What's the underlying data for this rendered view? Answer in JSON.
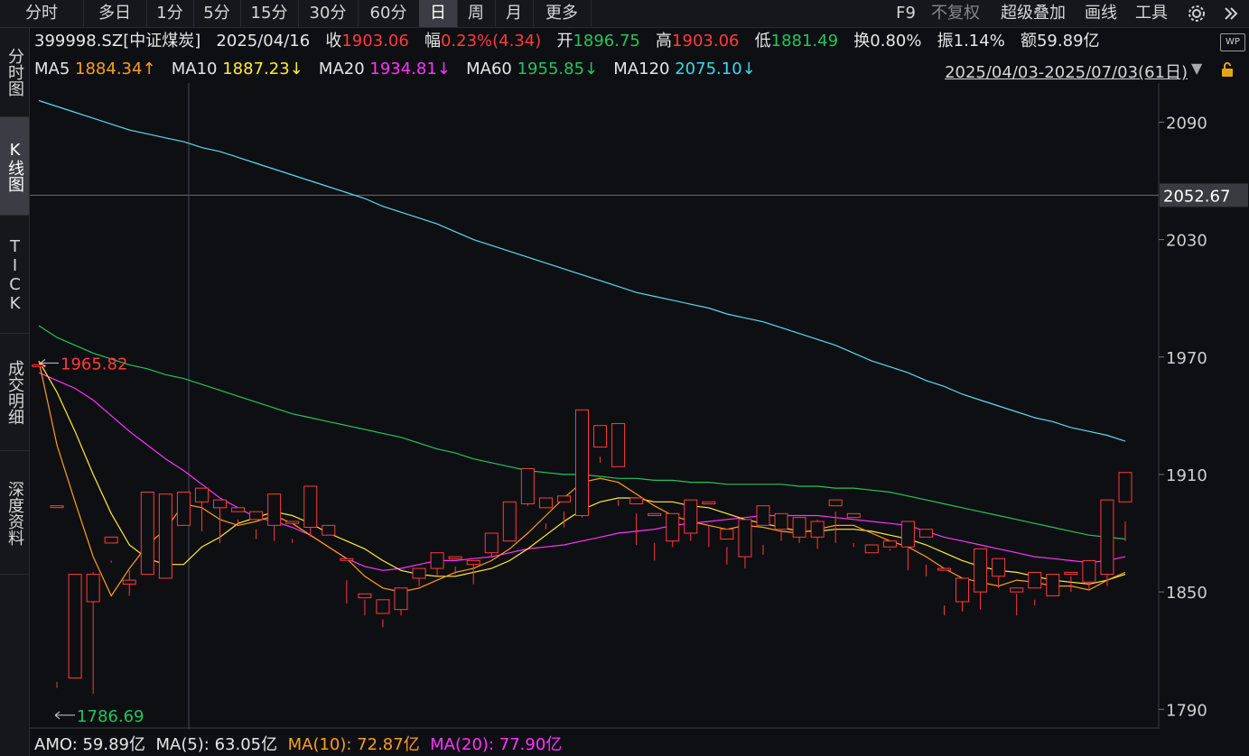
{
  "toolbar": {
    "tabs": [
      "分时",
      "多日",
      "1分",
      "5分",
      "15分",
      "30分",
      "60分",
      "日",
      "周",
      "月",
      "更多"
    ],
    "active_tab": "日",
    "right_tools": [
      "F9",
      "不复权",
      "超级叠加",
      "画线",
      "工具"
    ]
  },
  "sidebar": {
    "tabs": [
      "分时图",
      "K线图",
      "TICK",
      "成交明细",
      "深度资料"
    ],
    "active_tab": "K线图"
  },
  "info": {
    "symbol": "399998.SZ[中证煤炭]",
    "date": "2025/04/16",
    "close_label": "收",
    "close": "1903.06",
    "change_label": "幅",
    "change": "0.23%(4.34)",
    "open_label": "开",
    "open": "1896.75",
    "high_label": "高",
    "high": "1903.06",
    "low_label": "低",
    "low": "1881.49",
    "turnover_label": "换",
    "turnover": "0.80%",
    "amplitude_label": "振",
    "amplitude": "1.14%",
    "amount_label": "额",
    "amount": "59.89亿",
    "wp_badge": "WP"
  },
  "ma_line": {
    "ma5_label": "MA5",
    "ma5": "1884.34↑",
    "ma10_label": "MA10",
    "ma10": "1887.23↓",
    "ma20_label": "MA20",
    "ma20": "1934.81↓",
    "ma60_label": "MA60",
    "ma60": "1955.85↓",
    "ma120_label": "MA120",
    "ma120": "2075.10↓"
  },
  "range": "2025/04/03-2025/07/03(61日)",
  "amo": {
    "amo": "AMO: 59.89亿",
    "ma5": "MA(5): 63.05亿",
    "ma10": "MA(10): 72.87亿",
    "ma20": "MA(20): 77.90亿"
  },
  "colors": {
    "up": "#ff3b3b",
    "down": "#33d6d6",
    "ma5": "#ff9d1a",
    "ma10": "#ffee33",
    "ma20": "#ff33ff",
    "ma60": "#22c55e",
    "ma120": "#55ddee"
  },
  "chart_data": {
    "type": "candlestick",
    "y_ticks": [
      "2090",
      "2030",
      "1970",
      "1910",
      "1850",
      "1790"
    ],
    "ylim": [
      1780,
      2110
    ],
    "crosshair_label": "2052.67",
    "max_label": "1965.82",
    "min_label": "1786.69",
    "candles": [
      [
        1966,
        1966,
        1952,
        1952
      ],
      [
        1894,
        1894,
        1801,
        1804
      ],
      [
        1806,
        1859,
        1806,
        1859
      ],
      [
        1845,
        1859,
        1798,
        1860
      ],
      [
        1875,
        1878,
        1865,
        1866
      ],
      [
        1854,
        1856,
        1848,
        1861
      ],
      [
        1859,
        1901,
        1859,
        1899
      ],
      [
        1857,
        1900,
        1857,
        1899
      ],
      [
        1884,
        1901,
        1884,
        1899
      ],
      [
        1896,
        1903,
        1881,
        1903
      ],
      [
        1893,
        1897,
        1875,
        1897
      ],
      [
        1891,
        1893,
        1885,
        1887
      ],
      [
        1887,
        1891,
        1877,
        1882
      ],
      [
        1884,
        1900,
        1876,
        1884
      ],
      [
        1885,
        1886,
        1875,
        1877
      ],
      [
        1883,
        1904,
        1878,
        1885
      ],
      [
        1879,
        1884,
        1874,
        1874
      ],
      [
        1867,
        1867,
        1844,
        1856
      ],
      [
        1847,
        1849,
        1838,
        1846
      ],
      [
        1839,
        1846,
        1836,
        1832
      ],
      [
        1841,
        1852,
        1838,
        1852
      ],
      [
        1857,
        1862,
        1853,
        1862
      ],
      [
        1862,
        1870,
        1858,
        1864
      ],
      [
        1867,
        1868,
        1859,
        1863
      ],
      [
        1864,
        1866,
        1854,
        1865
      ],
      [
        1870,
        1880,
        1868,
        1874
      ],
      [
        1876,
        1896,
        1876,
        1896
      ],
      [
        1895,
        1913,
        1894,
        1896
      ],
      [
        1893,
        1898,
        1882,
        1885
      ],
      [
        1896,
        1899,
        1883,
        1891
      ],
      [
        1889,
        1943,
        1888,
        1933
      ],
      [
        1924,
        1935,
        1916,
        1919
      ],
      [
        1914,
        1936,
        1894,
        1897
      ],
      [
        1895,
        1898,
        1874,
        1890
      ],
      [
        1889,
        1890,
        1866,
        1875
      ],
      [
        1876,
        1890,
        1873,
        1888
      ],
      [
        1880,
        1897,
        1876,
        1897
      ],
      [
        1895,
        1896,
        1873,
        1884
      ],
      [
        1877,
        1882,
        1864,
        1873
      ],
      [
        1868,
        1887,
        1862,
        1885
      ],
      [
        1884,
        1894,
        1869,
        1874
      ],
      [
        1882,
        1890,
        1876,
        1882
      ],
      [
        1878,
        1888,
        1875,
        1885
      ],
      [
        1878,
        1886,
        1872,
        1887
      ],
      [
        1894,
        1897,
        1875,
        1891
      ],
      [
        1888,
        1890,
        1873,
        1875
      ],
      [
        1870,
        1874,
        1866,
        1866
      ],
      [
        1873,
        1876,
        1872,
        1871
      ],
      [
        1873,
        1886,
        1861,
        1886
      ],
      [
        1878,
        1882,
        1858,
        1864
      ],
      [
        1862,
        1862,
        1838,
        1843
      ],
      [
        1845,
        1857,
        1840,
        1845
      ],
      [
        1850,
        1872,
        1841,
        1869
      ],
      [
        1858,
        1867,
        1852,
        1863
      ],
      [
        1850,
        1852,
        1838,
        1849
      ],
      [
        1852,
        1860,
        1846,
        1843
      ],
      [
        1848,
        1859,
        1848,
        1858
      ],
      [
        1859,
        1860,
        1850,
        1858
      ],
      [
        1855,
        1866,
        1851,
        1860
      ],
      [
        1859,
        1897,
        1853,
        1897
      ],
      [
        1896,
        1911,
        1876,
        1886
      ]
    ],
    "ma5": [
      1968,
      1925,
      1896,
      1868,
      1848,
      1862,
      1874,
      1882,
      1895,
      1893,
      1887,
      1884,
      1886,
      1889,
      1885,
      1879,
      1873,
      1867,
      1858,
      1852,
      1850,
      1852,
      1856,
      1860,
      1862,
      1866,
      1872,
      1880,
      1889,
      1898,
      1906,
      1908,
      1906,
      1900,
      1894,
      1889,
      1886,
      1884,
      1882,
      1884,
      1883,
      1881,
      1880,
      1882,
      1884,
      1884,
      1880,
      1876,
      1873,
      1868,
      1862,
      1857,
      1855,
      1853,
      1856,
      1855,
      1853,
      1853,
      1851,
      1856,
      1860
    ],
    "ma10": [
      1968,
      1952,
      1932,
      1910,
      1890,
      1874,
      1867,
      1864,
      1864,
      1873,
      1878,
      1885,
      1888,
      1891,
      1889,
      1885,
      1880,
      1876,
      1872,
      1866,
      1861,
      1859,
      1858,
      1858,
      1860,
      1862,
      1866,
      1872,
      1879,
      1886,
      1892,
      1896,
      1898,
      1898,
      1896,
      1896,
      1894,
      1893,
      1890,
      1887,
      1885,
      1883,
      1881,
      1881,
      1882,
      1882,
      1881,
      1879,
      1877,
      1874,
      1870,
      1866,
      1863,
      1861,
      1860,
      1858,
      1856,
      1855,
      1854,
      1856,
      1859
    ],
    "ma20": [
      1962,
      1958,
      1954,
      1948,
      1940,
      1932,
      1925,
      1918,
      1912,
      1905,
      1898,
      1893,
      1888,
      1886,
      1883,
      1879,
      1873,
      1867,
      1863,
      1861,
      1862,
      1864,
      1866,
      1866,
      1867,
      1868,
      1870,
      1872,
      1873,
      1874,
      1876,
      1878,
      1880,
      1881,
      1882,
      1884,
      1885,
      1886,
      1887,
      1888,
      1889,
      1889,
      1889,
      1889,
      1888,
      1887,
      1886,
      1885,
      1884,
      1881,
      1878,
      1876,
      1874,
      1872,
      1870,
      1868,
      1867,
      1866,
      1865,
      1866,
      1868
    ],
    "ma60": [
      1986,
      1980,
      1976,
      1972,
      1969,
      1966,
      1964,
      1961,
      1959,
      1956,
      1953,
      1950,
      1947,
      1944,
      1941,
      1939,
      1937,
      1935,
      1933,
      1931,
      1929,
      1926,
      1923,
      1921,
      1918,
      1916,
      1914,
      1912,
      1911,
      1910,
      1910,
      1909,
      1908,
      1908,
      1907,
      1907,
      1906,
      1906,
      1905,
      1905,
      1905,
      1905,
      1904,
      1904,
      1903,
      1903,
      1902,
      1901,
      1899,
      1897,
      1895,
      1893,
      1891,
      1889,
      1887,
      1885,
      1883,
      1881,
      1879,
      1878,
      1877
    ],
    "ma120": [
      2101,
      2098,
      2095,
      2092,
      2089,
      2086,
      2084,
      2082,
      2080,
      2077,
      2075,
      2072,
      2069,
      2066,
      2063,
      2060,
      2057,
      2054,
      2051,
      2047,
      2044,
      2041,
      2038,
      2034,
      2030,
      2027,
      2024,
      2021,
      2018,
      2015,
      2012,
      2009,
      2006,
      2003,
      2001,
      1999,
      1997,
      1995,
      1992,
      1990,
      1988,
      1985,
      1982,
      1979,
      1976,
      1972,
      1968,
      1965,
      1962,
      1958,
      1955,
      1951,
      1948,
      1945,
      1942,
      1939,
      1937,
      1934,
      1932,
      1930,
      1927
    ]
  }
}
